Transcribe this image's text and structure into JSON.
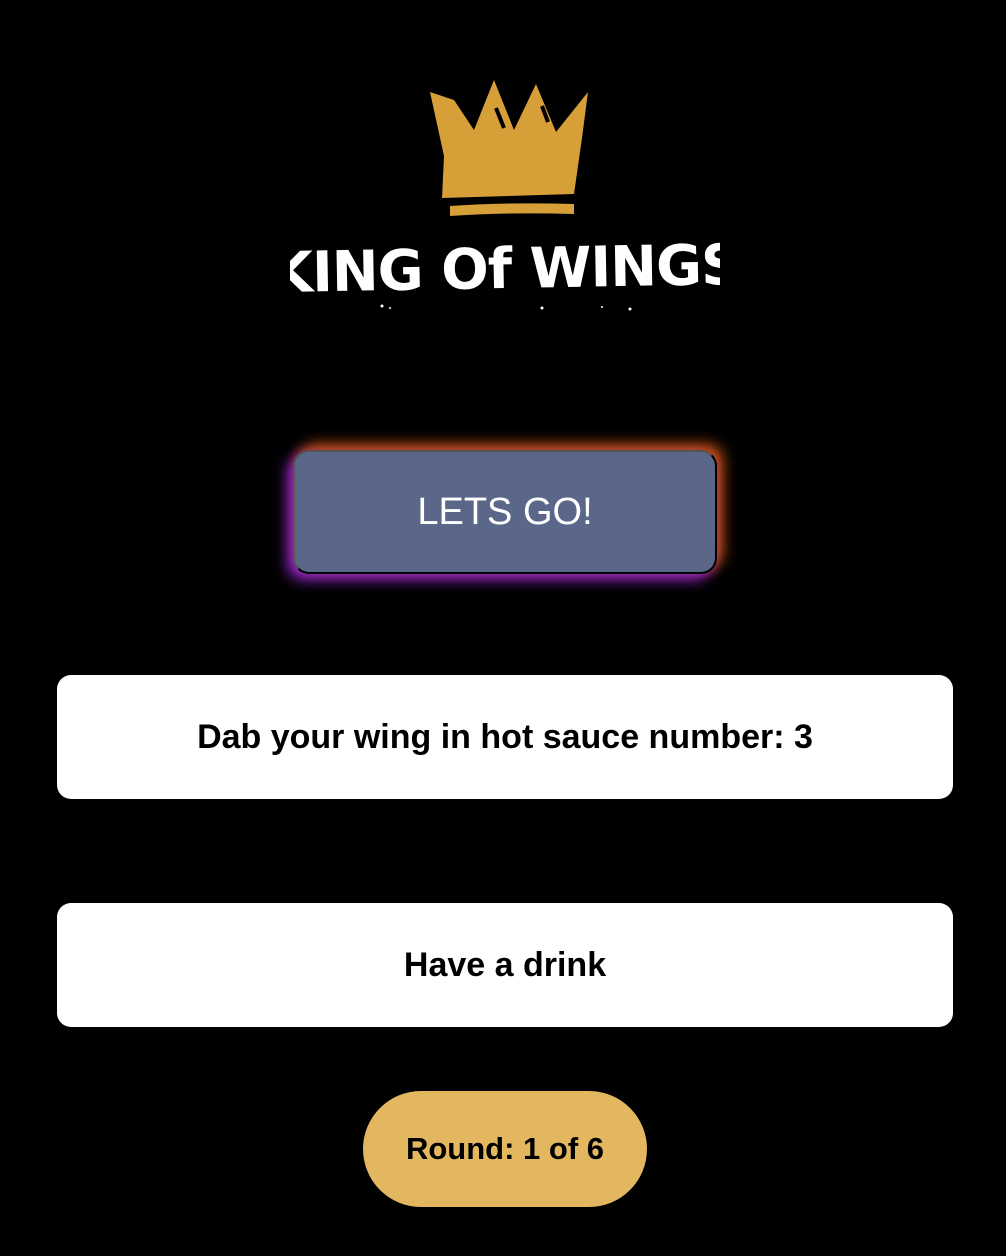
{
  "logo": {
    "icon": "crown-icon",
    "text": "KING Of WINGS",
    "crown_color": "#d79f38",
    "text_color": "#ffffff"
  },
  "actions": {
    "start_label": "LETS GO!"
  },
  "cards": [
    {
      "text": "Dab your wing in hot sauce number: 3"
    },
    {
      "text": "Have a drink"
    }
  ],
  "round": {
    "label": "Round: 1 of 6",
    "current": 1,
    "total": 6
  },
  "colors": {
    "background": "#000000",
    "button": "#5a6788",
    "button_glow_left": "#9c2ae2",
    "button_glow_right": "#e66014",
    "card": "#ffffff",
    "round_pill": "#e2b760"
  }
}
